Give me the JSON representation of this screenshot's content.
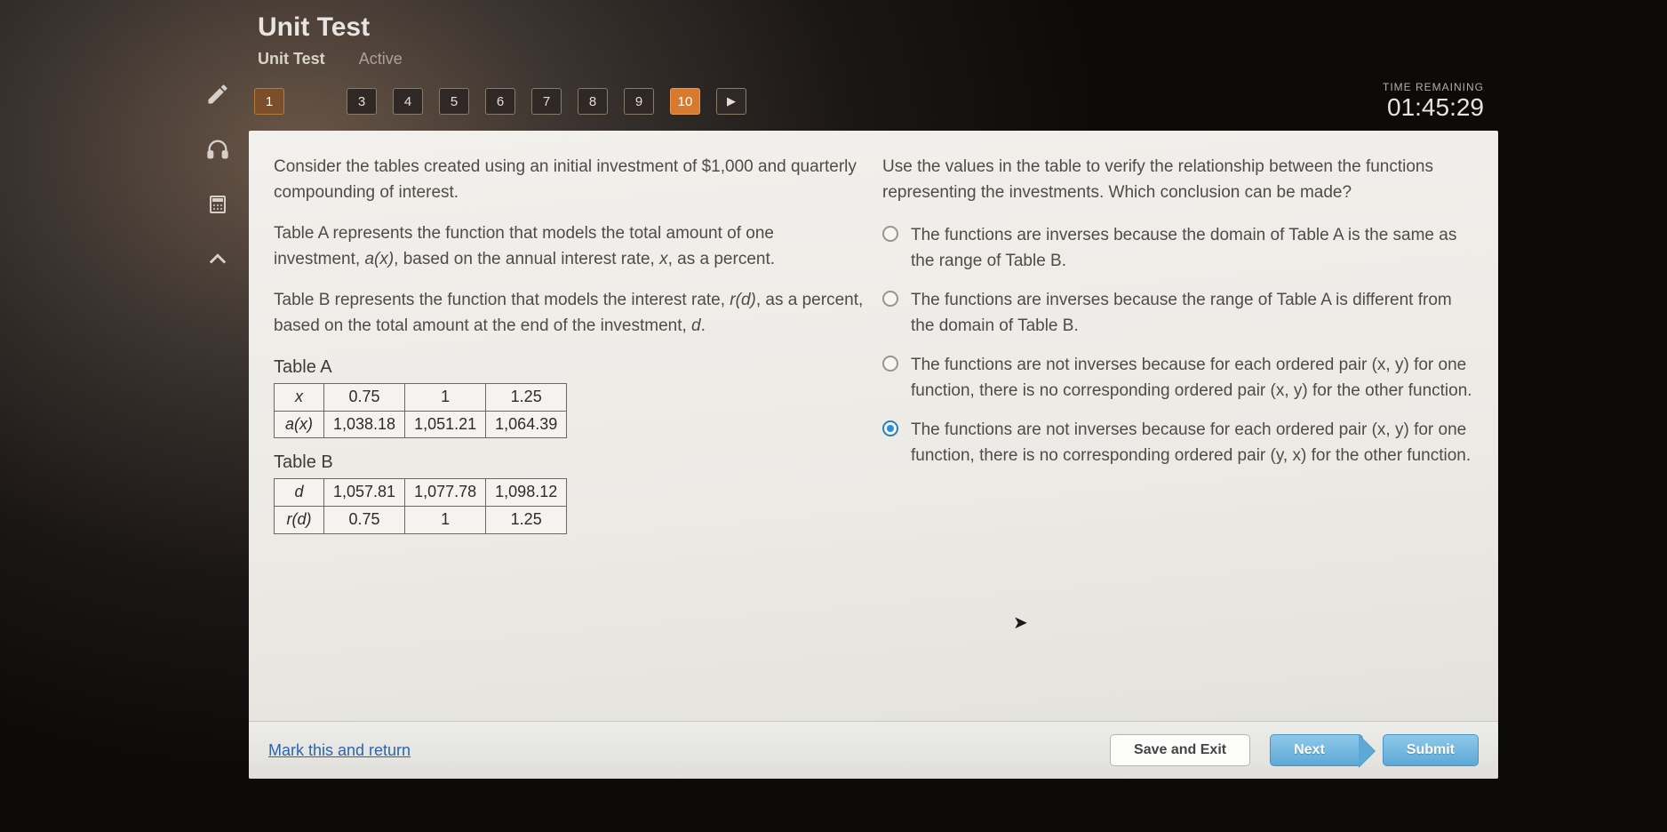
{
  "header": {
    "title": "Unit Test",
    "tab_active": "Unit Test",
    "tab_other": "Active"
  },
  "timer": {
    "label": "TIME REMAINING",
    "value": "01:45:29"
  },
  "questions": {
    "items": [
      "1",
      "",
      "3",
      "4",
      "5",
      "6",
      "7",
      "8",
      "9",
      "10"
    ],
    "answered_index": 0,
    "current_index": 9,
    "arrow_glyph": "▶"
  },
  "left": {
    "p1": "Consider the tables created using an initial investment of $1,000 and quarterly compounding of interest.",
    "p2_a": "Table A represents the function that models the total amount of one investment, ",
    "p2_b": "a(x)",
    "p2_c": ", based on the annual interest rate, ",
    "p2_d": "x",
    "p2_e": ", as a percent.",
    "p3_a": "Table B represents the function that models the interest rate, ",
    "p3_b": "r(d)",
    "p3_c": ", as a percent, based on the total amount at the end of the investment, ",
    "p3_d": "d",
    "p3_e": ".",
    "tableA": {
      "title": "Table A",
      "row1_label": "x",
      "row2_label": "a(x)",
      "row1": [
        "0.75",
        "1",
        "1.25"
      ],
      "row2": [
        "1,038.18",
        "1,051.21",
        "1,064.39"
      ]
    },
    "tableB": {
      "title": "Table B",
      "row1_label": "d",
      "row2_label": "r(d)",
      "row1": [
        "1,057.81",
        "1,077.78",
        "1,098.12"
      ],
      "row2": [
        "0.75",
        "1",
        "1.25"
      ]
    }
  },
  "right": {
    "prompt": "Use the values in the table to verify the relationship between the functions representing the investments. Which conclusion can be made?",
    "choices": [
      "The functions are inverses because the domain of Table A is the same as the range of Table B.",
      "The functions are inverses because the range of Table A is different from the domain of Table B.",
      "The functions are not inverses because for each ordered pair (x, y) for one function, there is no corresponding ordered pair (x, y) for the other function.",
      "The functions are not inverses because for each ordered pair (x, y) for one function, there is no corresponding ordered pair (y, x) for the other function."
    ],
    "selected": 3
  },
  "footer": {
    "mark": "Mark this and return",
    "save": "Save and Exit",
    "next": "Next",
    "submit": "Submit"
  }
}
